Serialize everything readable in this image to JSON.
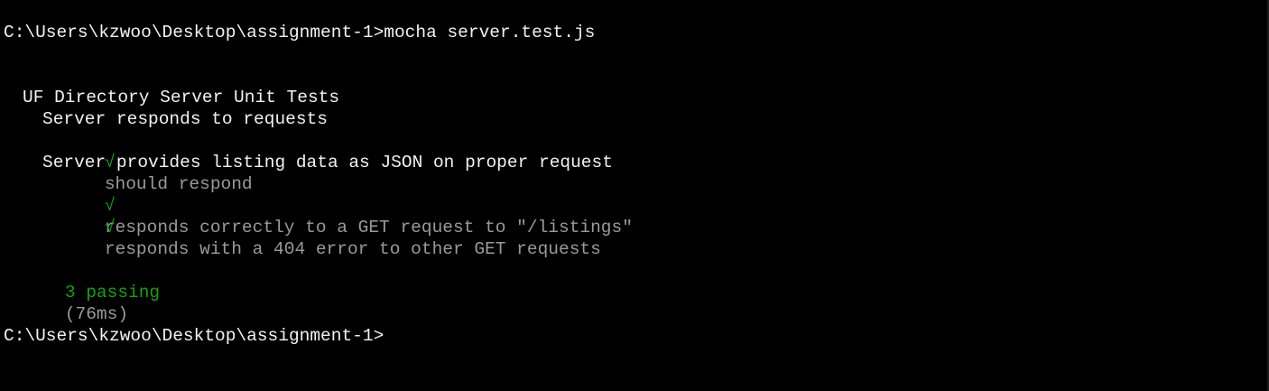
{
  "terminal": {
    "prompt_command": "C:\\Users\\kzwoo\\Desktop\\assignment-1>mocha server.test.js",
    "suite_title": "UF Directory Server Unit Tests",
    "groups": [
      {
        "title": "Server responds to requests",
        "tests": [
          {
            "mark": "√",
            "label": "should respond"
          }
        ]
      },
      {
        "title": "Server provides listing data as JSON on proper request",
        "tests": [
          {
            "mark": "√",
            "label": "responds correctly to a GET request to \"/listings\""
          },
          {
            "mark": "√",
            "label": "responds with a 404 error to other GET requests"
          }
        ]
      }
    ],
    "summary": {
      "passing": "3 passing",
      "duration": "(76ms)"
    },
    "prompt_final": "C:\\Users\\kzwoo\\Desktop\\assignment-1>"
  },
  "colors": {
    "background": "#000000",
    "text": "#f2f2f2",
    "dim_text": "#9a9a9a",
    "success": "#13a10e"
  }
}
